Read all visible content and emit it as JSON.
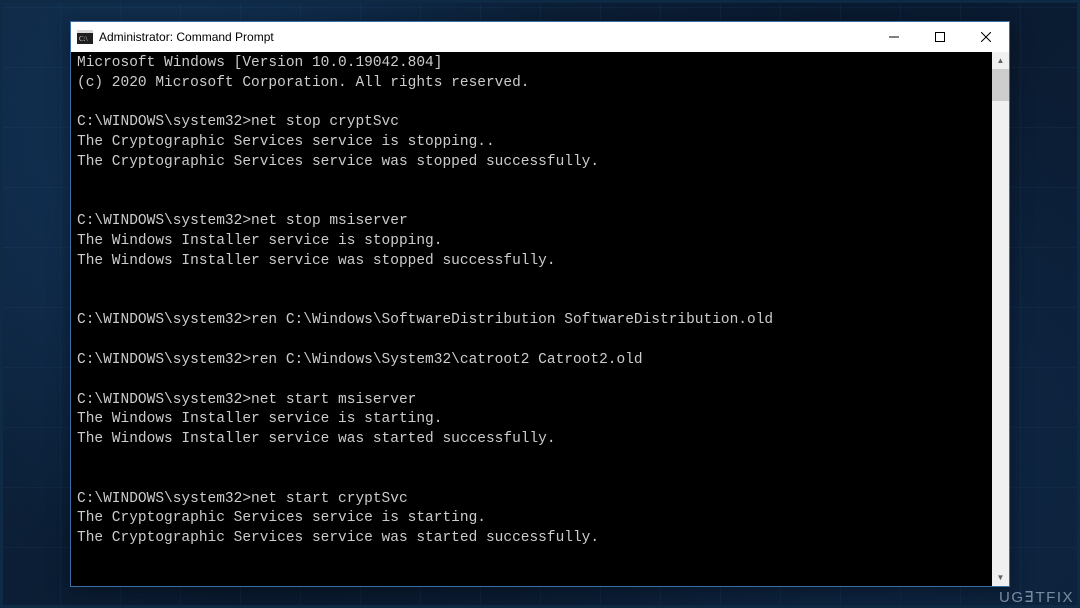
{
  "window": {
    "title": "Administrator: Command Prompt"
  },
  "console": {
    "lines": [
      "Microsoft Windows [Version 10.0.19042.804]",
      "(c) 2020 Microsoft Corporation. All rights reserved.",
      "",
      "C:\\WINDOWS\\system32>net stop cryptSvc",
      "The Cryptographic Services service is stopping..",
      "The Cryptographic Services service was stopped successfully.",
      "",
      "",
      "C:\\WINDOWS\\system32>net stop msiserver",
      "The Windows Installer service is stopping.",
      "The Windows Installer service was stopped successfully.",
      "",
      "",
      "C:\\WINDOWS\\system32>ren C:\\Windows\\SoftwareDistribution SoftwareDistribution.old",
      "",
      "C:\\WINDOWS\\system32>ren C:\\Windows\\System32\\catroot2 Catroot2.old",
      "",
      "C:\\WINDOWS\\system32>net start msiserver",
      "The Windows Installer service is starting.",
      "The Windows Installer service was started successfully.",
      "",
      "",
      "C:\\WINDOWS\\system32>net start cryptSvc",
      "The Cryptographic Services service is starting.",
      "The Cryptographic Services service was started successfully.",
      ""
    ]
  },
  "watermark": "UGⴺTFIX"
}
